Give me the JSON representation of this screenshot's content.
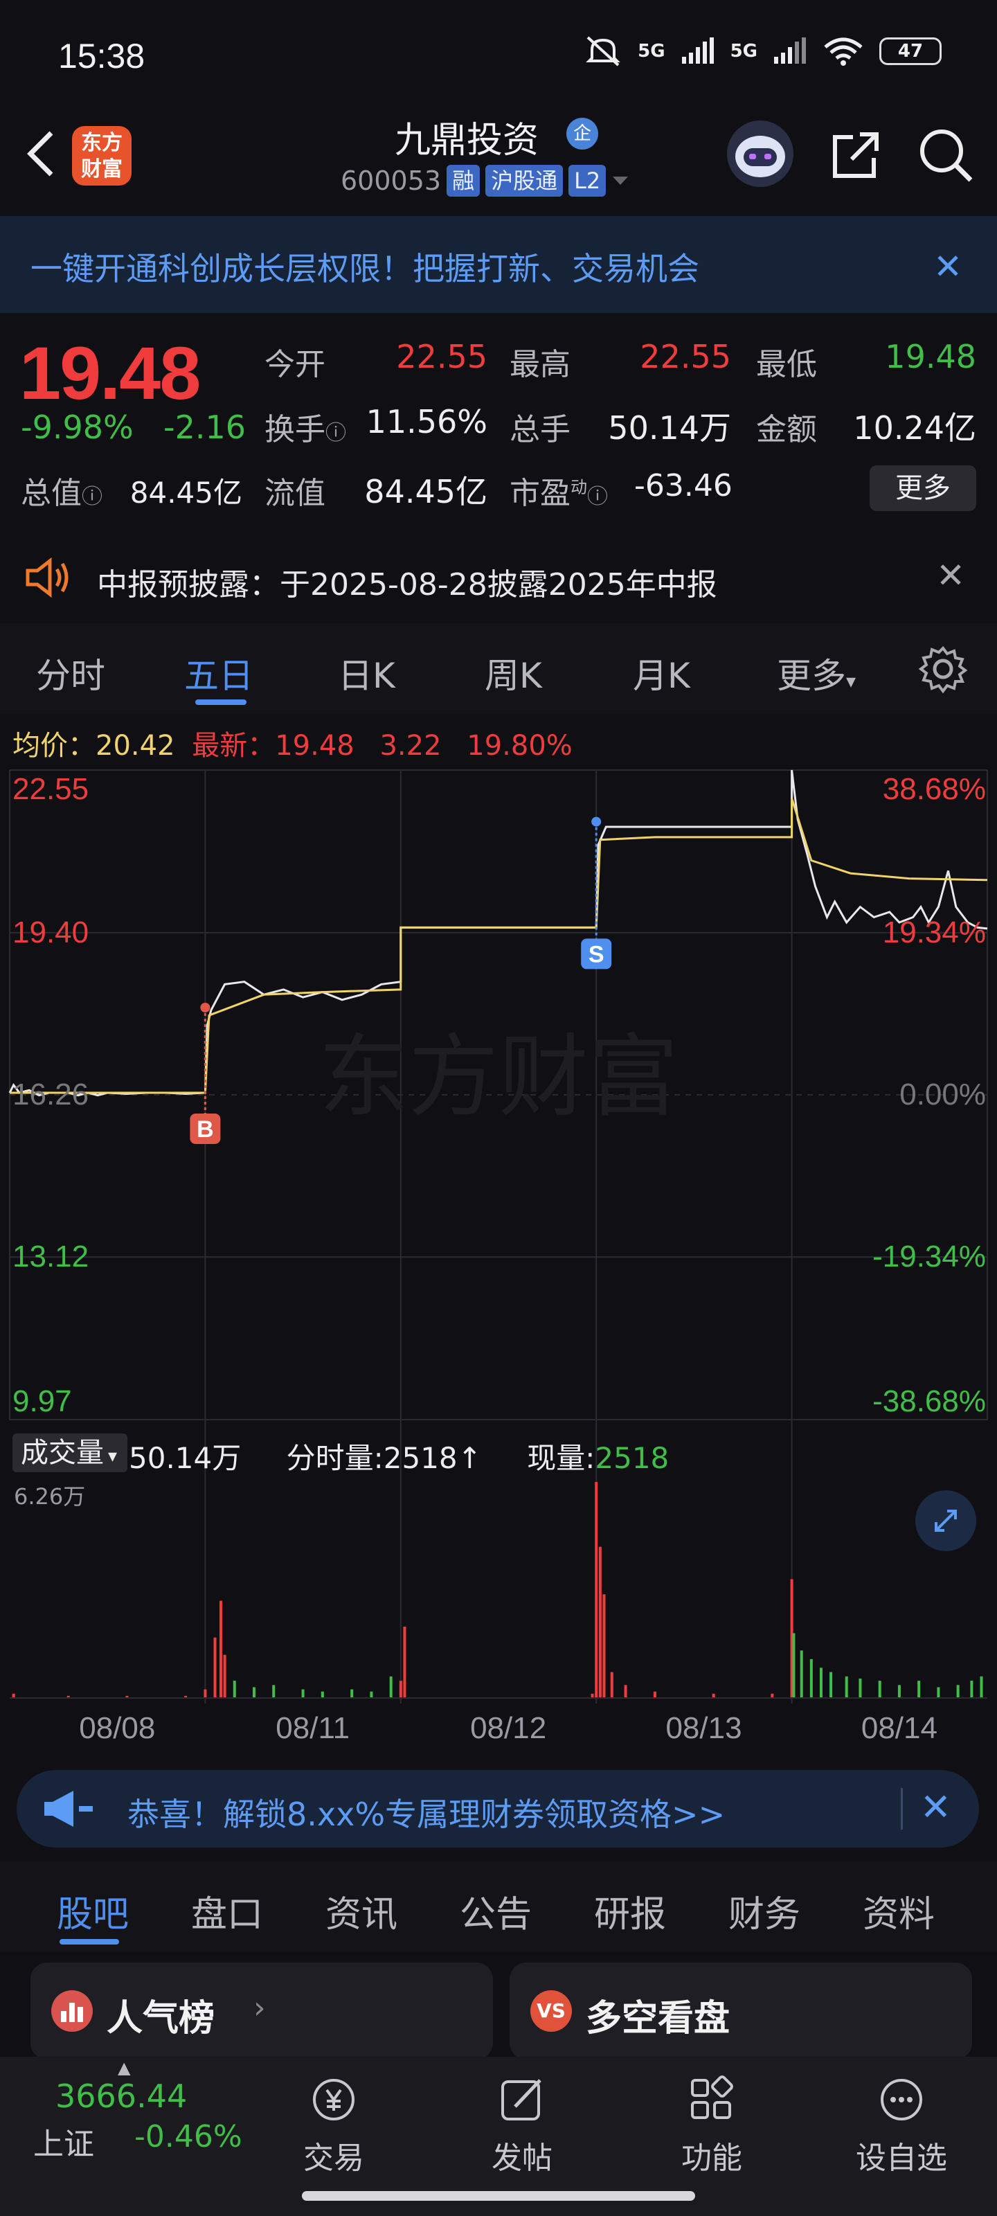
{
  "status_bar": {
    "time": "15:38",
    "network1": "5G",
    "network2": "5G",
    "battery": "47"
  },
  "header": {
    "logo_text": "东方财富",
    "stock_name": "九鼎投资",
    "enterprise_badge": "企",
    "stock_code": "600053",
    "tags": [
      "融",
      "沪股通",
      "L2"
    ]
  },
  "banner": {
    "text": "一键开通科创成长层权限！把握打新、交易机会"
  },
  "quote": {
    "price": "19.48",
    "change_pct": "-9.98%",
    "change": "-2.16",
    "open_label": "今开",
    "open": "22.55",
    "high_label": "最高",
    "high": "22.55",
    "low_label": "最低",
    "low": "19.48",
    "turnover_label": "换手",
    "turnover": "11.56%",
    "volume_label": "总手",
    "volume": "50.14万",
    "amount_label": "金额",
    "amount": "10.24亿",
    "mktcap_label": "总值",
    "mktcap": "84.45亿",
    "float_label": "流值",
    "float_cap": "84.45亿",
    "pe_label": "市盈",
    "pe_sup": "动",
    "pe": "-63.46",
    "more_label": "更多"
  },
  "notice": {
    "text": "中报预披露：于2025-08-28披露2025年中报"
  },
  "chart_tabs": [
    "分时",
    "五日",
    "日K",
    "周K",
    "月K",
    "更多"
  ],
  "chart_header": {
    "avg_label": "均价：",
    "avg": "20.42",
    "latest_label": "最新：",
    "latest": "19.48",
    "change": "3.22",
    "change_pct": "19.80%"
  },
  "volume_header": {
    "selector": "成交量",
    "total": "50.14万",
    "tick_label": "分时量:",
    "tick_value": "2518",
    "now_label": "现量:",
    "now_value": "2518",
    "max_label": "6.26万"
  },
  "chart_data": {
    "type": "line",
    "y_left_ticks": [
      "22.55",
      "19.40",
      "16.26",
      "13.12",
      "9.97"
    ],
    "y_right_ticks": [
      "38.68%",
      "19.34%",
      "0.00%",
      "-19.34%",
      "-38.68%"
    ],
    "x_labels": [
      "08/08",
      "08/11",
      "08/12",
      "08/13",
      "08/14"
    ],
    "ylim": [
      9.97,
      22.55
    ],
    "watermark": "东方财富",
    "markers": [
      {
        "label": "B",
        "day": "08/11"
      },
      {
        "label": "S",
        "day": "08/13"
      }
    ],
    "series": [
      {
        "name": "price",
        "points": [
          [
            0,
            16.3
          ],
          [
            0.02,
            16.45
          ],
          [
            0.05,
            16.3
          ],
          [
            0.1,
            16.35
          ],
          [
            0.15,
            16.25
          ],
          [
            0.2,
            16.3
          ],
          [
            0.25,
            16.3
          ],
          [
            0.3,
            16.3
          ],
          [
            0.35,
            16.25
          ],
          [
            0.4,
            16.3
          ],
          [
            0.45,
            16.25
          ],
          [
            0.5,
            16.3
          ],
          [
            0.6,
            16.28
          ],
          [
            0.7,
            16.3
          ],
          [
            0.8,
            16.3
          ],
          [
            0.9,
            16.28
          ],
          [
            1.0,
            16.3
          ],
          [
            1.01,
            17.6
          ],
          [
            1.03,
            17.9
          ],
          [
            1.1,
            18.4
          ],
          [
            1.2,
            18.45
          ],
          [
            1.3,
            18.2
          ],
          [
            1.4,
            18.3
          ],
          [
            1.5,
            18.15
          ],
          [
            1.6,
            18.25
          ],
          [
            1.7,
            18.1
          ],
          [
            1.8,
            18.2
          ],
          [
            1.9,
            18.4
          ],
          [
            2.0,
            18.45
          ],
          [
            2.0,
            19.5
          ],
          [
            3.0,
            19.5
          ],
          [
            3.01,
            21.1
          ],
          [
            3.05,
            21.45
          ],
          [
            3.2,
            21.45
          ],
          [
            4.0,
            21.45
          ],
          [
            4.0,
            22.55
          ],
          [
            4.03,
            21.6
          ],
          [
            4.08,
            20.9
          ],
          [
            4.12,
            20.3
          ],
          [
            4.18,
            19.7
          ],
          [
            4.22,
            20.0
          ],
          [
            4.28,
            19.6
          ],
          [
            4.35,
            19.9
          ],
          [
            4.42,
            19.7
          ],
          [
            4.5,
            19.8
          ],
          [
            4.55,
            19.6
          ],
          [
            4.62,
            19.7
          ],
          [
            4.66,
            19.9
          ],
          [
            4.7,
            19.6
          ],
          [
            4.75,
            19.9
          ],
          [
            4.8,
            20.6
          ],
          [
            4.84,
            19.9
          ],
          [
            4.9,
            19.6
          ],
          [
            4.95,
            19.5
          ],
          [
            5.0,
            19.48
          ]
        ]
      },
      {
        "name": "avg",
        "points": [
          [
            0,
            16.3
          ],
          [
            1.0,
            16.3
          ],
          [
            1.02,
            17.8
          ],
          [
            1.3,
            18.2
          ],
          [
            1.6,
            18.25
          ],
          [
            2.0,
            18.3
          ],
          [
            2.0,
            19.5
          ],
          [
            3.0,
            19.5
          ],
          [
            3.02,
            21.2
          ],
          [
            3.3,
            21.25
          ],
          [
            4.0,
            21.25
          ],
          [
            4.0,
            22.0
          ],
          [
            4.1,
            20.8
          ],
          [
            4.3,
            20.55
          ],
          [
            4.6,
            20.45
          ],
          [
            5.0,
            20.42
          ]
        ]
      }
    ],
    "volume": {
      "max": "6.26万",
      "bars": [
        [
          0.02,
          2
        ],
        [
          0.3,
          1
        ],
        [
          0.6,
          1
        ],
        [
          0.9,
          1
        ],
        [
          1.0,
          4
        ],
        [
          1.05,
          28
        ],
        [
          1.08,
          45
        ],
        [
          1.1,
          20
        ],
        [
          1.15,
          8
        ],
        [
          1.25,
          5
        ],
        [
          1.35,
          6
        ],
        [
          1.5,
          4
        ],
        [
          1.6,
          3
        ],
        [
          1.75,
          4
        ],
        [
          1.85,
          3
        ],
        [
          1.95,
          10
        ],
        [
          2.0,
          8
        ],
        [
          2.02,
          33
        ],
        [
          2.98,
          2
        ],
        [
          3.0,
          100
        ],
        [
          3.02,
          70
        ],
        [
          3.04,
          48
        ],
        [
          3.08,
          12
        ],
        [
          3.15,
          6
        ],
        [
          3.3,
          3
        ],
        [
          3.6,
          2
        ],
        [
          3.9,
          2
        ],
        [
          4.0,
          55
        ],
        [
          4.01,
          30
        ],
        [
          4.05,
          22
        ],
        [
          4.1,
          18
        ],
        [
          4.15,
          14
        ],
        [
          4.2,
          12
        ],
        [
          4.28,
          10
        ],
        [
          4.35,
          9
        ],
        [
          4.45,
          8
        ],
        [
          4.55,
          6
        ],
        [
          4.65,
          8
        ],
        [
          4.75,
          5
        ],
        [
          4.85,
          6
        ],
        [
          4.92,
          8
        ],
        [
          4.97,
          10
        ]
      ]
    }
  },
  "promo": {
    "text": "恭喜！解锁8.xx%专属理财券领取资格>>"
  },
  "info_tabs": [
    "股吧",
    "盘口",
    "资讯",
    "公告",
    "研报",
    "财务",
    "资料"
  ],
  "cards": [
    {
      "title": "人气榜",
      "icon_color": "#d9534f"
    },
    {
      "title": "多空看盘",
      "icon_color": "#e0533a"
    }
  ],
  "bottom_nav": {
    "index_value": "3666.44",
    "index_name": "上证",
    "index_change": "-0.46%",
    "items": [
      "交易",
      "发帖",
      "功能",
      "设自选"
    ]
  },
  "colors": {
    "up": "#f03c3c",
    "down": "#3fbf48",
    "accent": "#4e8ff0",
    "avg_line": "#f0d36a"
  }
}
